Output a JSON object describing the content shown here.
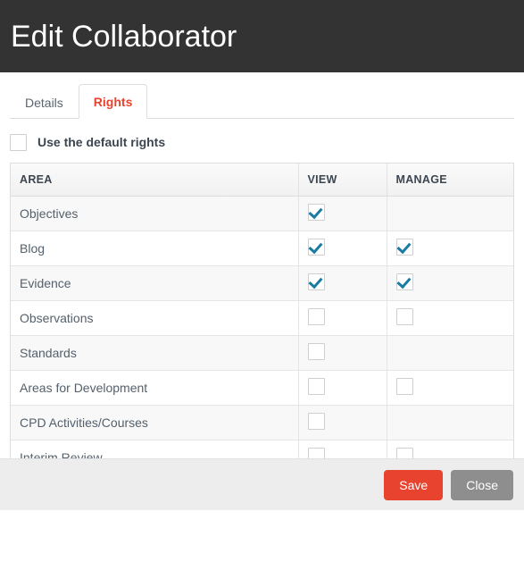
{
  "header": {
    "title": "Edit Collaborator"
  },
  "tabs": [
    {
      "label": "Details",
      "active": false
    },
    {
      "label": "Rights",
      "active": true
    }
  ],
  "default_rights": {
    "label": "Use the default rights",
    "checked": false
  },
  "table": {
    "columns": [
      "AREA",
      "VIEW",
      "MANAGE"
    ],
    "rows": [
      {
        "area": "Objectives",
        "view": "checked",
        "manage": "none"
      },
      {
        "area": "Blog",
        "view": "checked",
        "manage": "checked"
      },
      {
        "area": "Evidence",
        "view": "checked",
        "manage": "checked"
      },
      {
        "area": "Observations",
        "view": "unchecked",
        "manage": "unchecked"
      },
      {
        "area": "Standards",
        "view": "unchecked",
        "manage": "none"
      },
      {
        "area": "Areas for Development",
        "view": "unchecked",
        "manage": "unchecked"
      },
      {
        "area": "CPD Activities/Courses",
        "view": "unchecked",
        "manage": "none"
      },
      {
        "area": "Interim Review",
        "view": "unchecked",
        "manage": "unchecked"
      }
    ]
  },
  "footer": {
    "save_label": "Save",
    "close_label": "Close"
  },
  "colors": {
    "header_bg": "#333333",
    "accent_red": "#e8432e",
    "check_blue": "#1b7ba3",
    "close_gray": "#8e8e8e",
    "footer_bg": "#ededed"
  }
}
